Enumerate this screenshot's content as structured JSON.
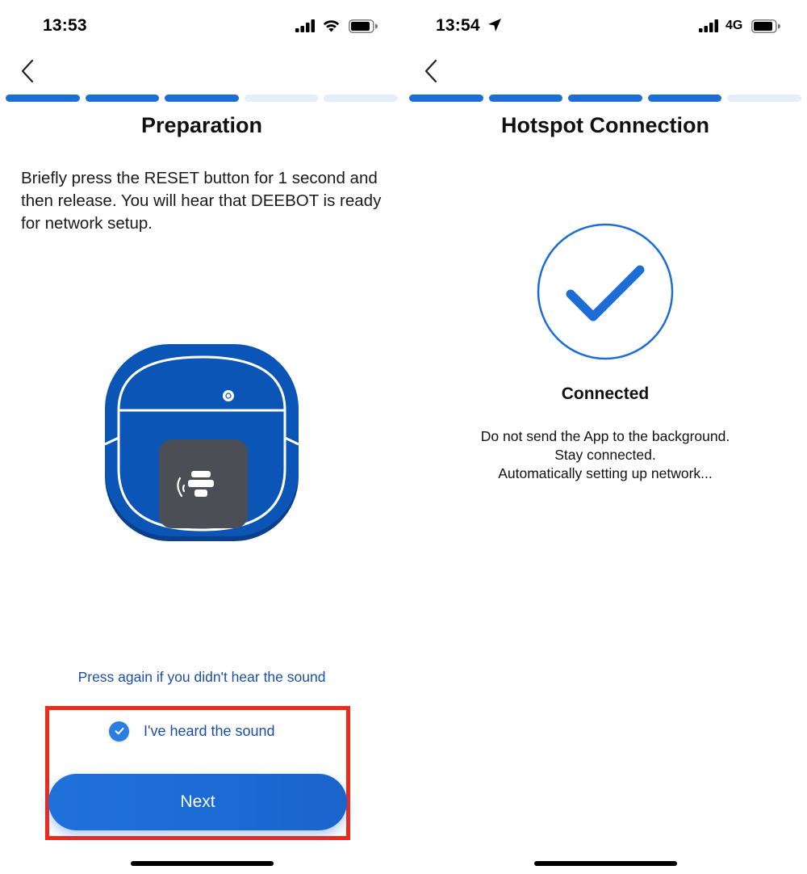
{
  "left_screen": {
    "status": {
      "time": "13:53",
      "network_icon": "wifi-icon",
      "battery_icon": "battery-icon"
    },
    "back_icon": "chevron-left-icon",
    "progress": {
      "total_steps": 5,
      "completed_steps": 3
    },
    "title": "Preparation",
    "instruction": "Briefly press the RESET button for 1 second and then release. You will hear that DEEBOT is ready for network setup.",
    "illustration": "robot-vacuum-illustration",
    "retry_link": "Press again if you didn't hear the sound",
    "checkbox": {
      "label": "I've heard the sound",
      "checked": true
    },
    "next_button": "Next"
  },
  "right_screen": {
    "status": {
      "time": "13:54",
      "network_label": "4G",
      "location_icon": "location-arrow-icon",
      "battery_icon": "battery-icon"
    },
    "back_icon": "chevron-left-icon",
    "progress": {
      "total_steps": 5,
      "completed_steps": 4
    },
    "title": "Hotspot Connection",
    "status_icon": "checkmark-circle-icon",
    "connected_label": "Connected",
    "messages": [
      "Do not send the App to the background.",
      "Stay connected.",
      "Automatically setting up network..."
    ]
  },
  "colors": {
    "accent": "#1c6ed6",
    "link": "#1b4fa8",
    "progress_inactive": "#e4edf8",
    "robot_body": "#0b55b7",
    "annotation_red": "#ee2a1b"
  }
}
